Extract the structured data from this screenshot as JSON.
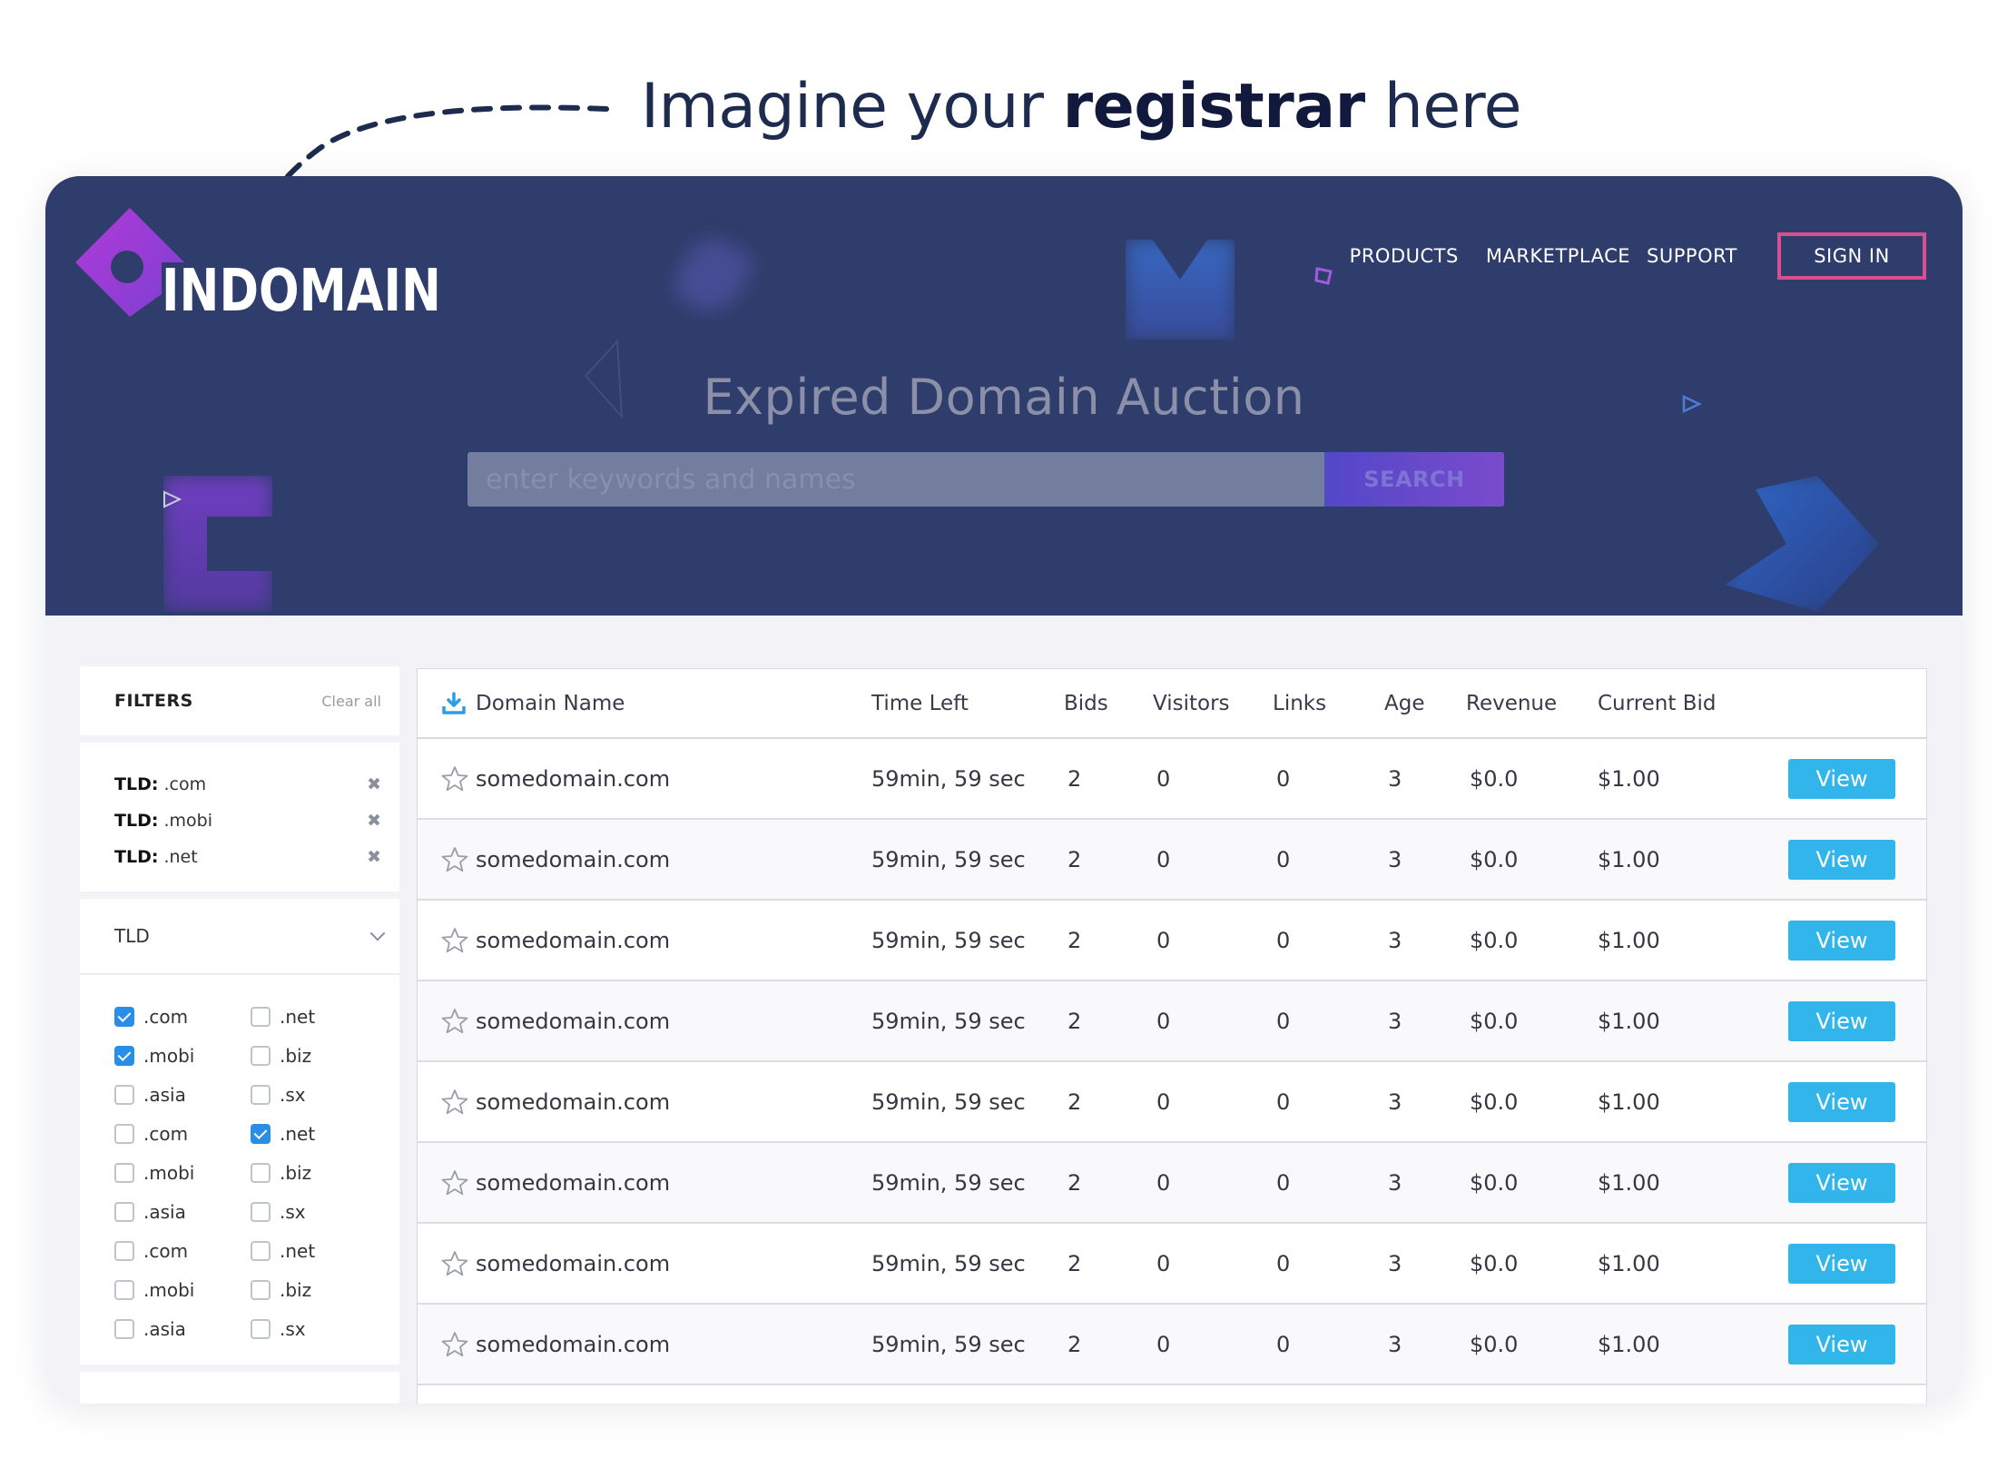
{
  "annotation": {
    "prefix": "Imagine your ",
    "bold": "registrar",
    "suffix": " here"
  },
  "brand": {
    "name": "INDOMAIN"
  },
  "nav": {
    "products": "PRODUCTS",
    "marketplace": "MARKETPLACE",
    "support": "SUPPORT",
    "sign_in": "SIGN IN"
  },
  "hero": {
    "title": "Expired Domain Auction",
    "search_placeholder": "enter keywords and names",
    "search_button": "SEARCH"
  },
  "filters": {
    "title": "FILTERS",
    "clear_all": "Clear all",
    "active": [
      {
        "key": "TLD:",
        "value": " .com"
      },
      {
        "key": "TLD:",
        "value": " .mobi"
      },
      {
        "key": "TLD:",
        "value": " .net"
      }
    ],
    "tld_header": "TLD",
    "tld_options": [
      {
        "label": ".com",
        "checked": true
      },
      {
        "label": ".net",
        "checked": false
      },
      {
        "label": ".mobi",
        "checked": true
      },
      {
        "label": ".biz",
        "checked": false
      },
      {
        "label": ".asia",
        "checked": false
      },
      {
        "label": ".sx",
        "checked": false
      },
      {
        "label": ".com",
        "checked": false
      },
      {
        "label": ".net",
        "checked": true
      },
      {
        "label": ".mobi",
        "checked": false
      },
      {
        "label": ".biz",
        "checked": false
      },
      {
        "label": ".asia",
        "checked": false
      },
      {
        "label": ".sx",
        "checked": false
      },
      {
        "label": ".com",
        "checked": false
      },
      {
        "label": ".net",
        "checked": false
      },
      {
        "label": ".mobi",
        "checked": false
      },
      {
        "label": ".biz",
        "checked": false
      },
      {
        "label": ".asia",
        "checked": false
      },
      {
        "label": ".sx",
        "checked": false
      }
    ]
  },
  "table": {
    "columns": [
      "Domain Name",
      "Time Left",
      "Bids",
      "Visitors",
      "Links",
      "Age",
      "Revenue",
      "Current Bid"
    ],
    "view_label": "View",
    "rows": [
      {
        "domain": "somedomain.com",
        "time_left": "59min, 59 sec",
        "bids": "2",
        "visitors": "0",
        "links": "0",
        "age": "3",
        "revenue": "$0.0",
        "current_bid": "$1.00"
      },
      {
        "domain": "somedomain.com",
        "time_left": "59min, 59 sec",
        "bids": "2",
        "visitors": "0",
        "links": "0",
        "age": "3",
        "revenue": "$0.0",
        "current_bid": "$1.00"
      },
      {
        "domain": "somedomain.com",
        "time_left": "59min, 59 sec",
        "bids": "2",
        "visitors": "0",
        "links": "0",
        "age": "3",
        "revenue": "$0.0",
        "current_bid": "$1.00"
      },
      {
        "domain": "somedomain.com",
        "time_left": "59min, 59 sec",
        "bids": "2",
        "visitors": "0",
        "links": "0",
        "age": "3",
        "revenue": "$0.0",
        "current_bid": "$1.00"
      },
      {
        "domain": "somedomain.com",
        "time_left": "59min, 59 sec",
        "bids": "2",
        "visitors": "0",
        "links": "0",
        "age": "3",
        "revenue": "$0.0",
        "current_bid": "$1.00"
      },
      {
        "domain": "somedomain.com",
        "time_left": "59min, 59 sec",
        "bids": "2",
        "visitors": "0",
        "links": "0",
        "age": "3",
        "revenue": "$0.0",
        "current_bid": "$1.00"
      },
      {
        "domain": "somedomain.com",
        "time_left": "59min, 59 sec",
        "bids": "2",
        "visitors": "0",
        "links": "0",
        "age": "3",
        "revenue": "$0.0",
        "current_bid": "$1.00"
      },
      {
        "domain": "somedomain.com",
        "time_left": "59min, 59 sec",
        "bids": "2",
        "visitors": "0",
        "links": "0",
        "age": "3",
        "revenue": "$0.0",
        "current_bid": "$1.00"
      }
    ]
  },
  "colors": {
    "hero_bg": "#2e3d6b",
    "accent_pink": "#d74f8f",
    "view_blue": "#31b5ea",
    "checkbox_blue": "#2a8de6",
    "logo_purple": "#a03fd8"
  },
  "icons": {
    "download": "download-icon",
    "star": "star-outline-icon",
    "remove": "close-x-icon",
    "chevron": "chevron-down-icon"
  }
}
